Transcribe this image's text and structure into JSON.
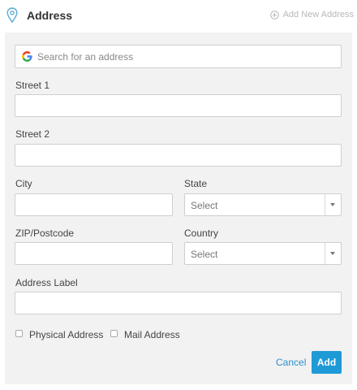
{
  "header": {
    "title": "Address",
    "add_new_label": "Add New Address"
  },
  "form": {
    "search": {
      "placeholder": "Search for an address",
      "value": ""
    },
    "street1": {
      "label": "Street 1",
      "value": ""
    },
    "street2": {
      "label": "Street 2",
      "value": ""
    },
    "city": {
      "label": "City",
      "value": ""
    },
    "state": {
      "label": "State",
      "selected": "Select"
    },
    "zip": {
      "label": "ZIP/Postcode",
      "value": ""
    },
    "country": {
      "label": "Country",
      "selected": "Select"
    },
    "address_label": {
      "label": "Address Label",
      "value": ""
    },
    "checkboxes": [
      {
        "label": "Physical Address",
        "checked": false
      },
      {
        "label": "Mail Address",
        "checked": false
      }
    ]
  },
  "actions": {
    "cancel_label": "Cancel",
    "add_label": "Add"
  },
  "colors": {
    "accent": "#1e9ad6",
    "link": "#2a8fd0",
    "panel_bg": "#f2f2f2",
    "pin_icon": "#5aa9d6"
  }
}
